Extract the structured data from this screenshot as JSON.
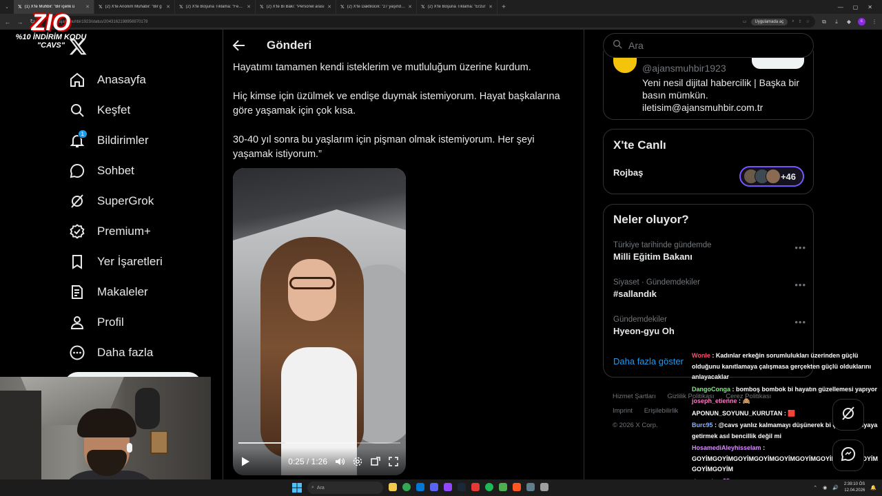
{
  "browser": {
    "tabs": [
      {
        "label": "(1) X'te Muhbir: \"Bir içerik ü",
        "active": true
      },
      {
        "label": "(2) X'te Anonim Muhabir: \"Bir g",
        "active": false
      },
      {
        "label": "(2) X'te Boşuna Tıklama: \"Fenon",
        "active": false
      },
      {
        "label": "(2) X'te Bi Bakı: \"Personel arası",
        "active": false
      },
      {
        "label": "(2) X'te Daktilocık: \"27 yaşınday",
        "active": false
      },
      {
        "label": "(2) X'te Boşuna Tıklama: \"Erzur",
        "active": false
      }
    ],
    "url": "x.com/ajansmuhbir1923/status/2043162198956970178",
    "app_button": "Uygulamada aç"
  },
  "promo": {
    "big": "ZIO",
    "line1": "%10 İNDİRİM KODU",
    "line2": "\"CAVS\""
  },
  "nav": {
    "items": [
      {
        "label": "Anasayfa",
        "icon": "home-icon"
      },
      {
        "label": "Keşfet",
        "icon": "search-icon"
      },
      {
        "label": "Bildirimler",
        "icon": "bell-icon",
        "badge": "1"
      },
      {
        "label": "Sohbet",
        "icon": "chat-icon"
      },
      {
        "label": "SuperGrok",
        "icon": "grok-icon"
      },
      {
        "label": "Premium+",
        "icon": "verified-icon"
      },
      {
        "label": "Yer İşaretleri",
        "icon": "bookmark-icon"
      },
      {
        "label": "Makaleler",
        "icon": "article-icon"
      },
      {
        "label": "Profil",
        "icon": "user-icon"
      },
      {
        "label": "Daha fazla",
        "icon": "more-icon"
      }
    ]
  },
  "post": {
    "header_title": "Gönderi",
    "paragraphs": [
      "Hayatımı tamamen kendi isteklerim ve mutluluğum üzerine kurdum.",
      "Hiç kimse için üzülmek ve endişe duymak istemiyorum. Hayat başkalarına göre yaşamak için çok kısa.",
      "30-40 yıl sonra bu yaşlarım için pişman olmak istemiyorum. Her şeyi yaşamak istiyorum.”"
    ],
    "video": {
      "time": "0:25 / 1:26",
      "progress": 0.29
    }
  },
  "sidebar": {
    "search_placeholder": "Ara",
    "profile": {
      "handle": "@ajansmuhbir1923",
      "bio": "Yeni nesil dijital habercilik | Başka bir basın mümkün.",
      "email": "iletisim@ajansmuhbir.com.tr"
    },
    "live": {
      "title": "X'te Canlı",
      "host": "Rojbaş",
      "count": "+46"
    },
    "trends": {
      "title": "Neler oluyor?",
      "items": [
        {
          "category": "Türkiye tarihinde gündemde",
          "name": "Milli Eğitim Bakanı"
        },
        {
          "category": "Siyaset · Gündemdekiler",
          "name": "#sallandık"
        },
        {
          "category": "Gündemdekiler",
          "name": "Hyeon-gyu Oh"
        }
      ],
      "more": "Daha fazla göster"
    },
    "footer": {
      "links": [
        "Hizmet Şartları",
        "Gizlilik Politikası",
        "Çerez Politikası",
        "Imprint",
        "Erişilebilirlik"
      ],
      "copyright": "© 2026 X Corp."
    }
  },
  "chat": [
    {
      "user": "Wonle",
      "color": "#ff4f6d",
      "text": ": Kadınlar erkeğin sorumlulukları üzerinden güçlü olduğunu kanıtlamaya çalışmasa gerçekten güçlü olduklarını anlayacaklar"
    },
    {
      "user": "DangoConga",
      "color": "#7cf07c",
      "text": ": bomboş bombok bi hayatın güzellemesi yapıyor"
    },
    {
      "user": "joseph_etienne",
      "color": "#ff79c6",
      "text": ": 🙈"
    },
    {
      "user": "APONUN_SOYUNU_KURUTAN",
      "color": "#ffffff",
      "text": ": 🟥"
    },
    {
      "user": "Burc95",
      "color": "#8ab4ff",
      "text": ": @cavs yanlız kalmamayı düşünerek bi çocuk dünyaya getirmek asıl bencillik değil mi"
    },
    {
      "user": "HosamediAleyhisselam",
      "color": "#d98cff",
      "text": ": GOYİMGOYİMGOYİMGOYİMGOYİMGOYİMGOYİMGOYİMGOYİM GOYİMGOYİM"
    },
    {
      "user": "rinaxwin",
      "color": "#8ab4ff",
      "text": ": 💜"
    }
  ],
  "taskbar": {
    "search": "Ara",
    "time": "2:39:10 ÖS",
    "date": "12.04.2026"
  },
  "colors": {
    "accent": "#1d9bf0",
    "border": "#2f3336",
    "muted": "#71767b",
    "live_ring": "#7856ff"
  }
}
